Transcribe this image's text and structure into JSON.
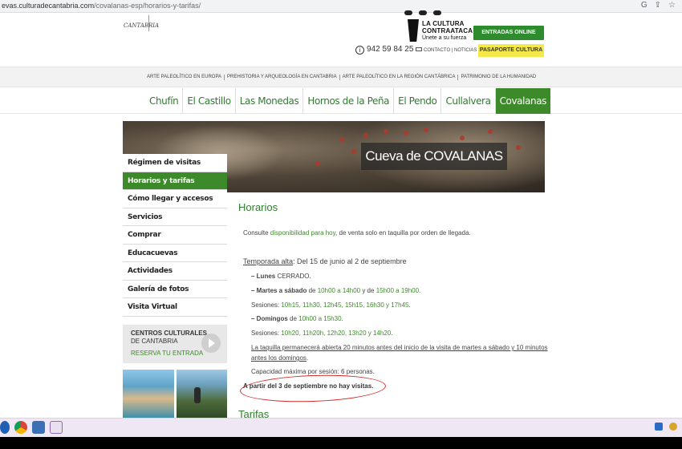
{
  "browser": {
    "url_host": "evas.culturadecantabria.com",
    "url_path": "/covalanas-esp/horarios-y-tarifas/"
  },
  "header": {
    "logo_text": "CANTABRIA",
    "cultura_line1": "LA CULTURA",
    "cultura_line2": "CONTRAATACA",
    "cultura_line3": "Únete a su fuerza",
    "entradas_label": "ENTRADAS ONLINE",
    "pasaporte_label": "PASAPORTE CULTURA",
    "phone": "942 59 84 25",
    "contacto": "CONTACTO",
    "noticias": "NOTICIAS"
  },
  "topnav": {
    "items": [
      "ARTE PALEOLÍTICO EN EUROPA",
      "PREHISTORIA Y ARQUEOLOGÍA EN CANTABRIA",
      "ARTE PALEOLÍTICO EN LA REGIÓN CANTÁBRICA",
      "PATRIMONIO DE LA HUMANIDAD"
    ]
  },
  "cavenav": {
    "tabs": [
      "Chufín",
      "El Castillo",
      "Las Monedas",
      "Hornos de la Peña",
      "El Pendo",
      "Cullalvera",
      "Covalanas"
    ],
    "active_index": 6
  },
  "banner": {
    "title": "Cueva de COVALANAS"
  },
  "sidebar": {
    "items": [
      "Régimen de visitas",
      "Horarios y tarifas",
      "Cómo llegar y accesos",
      "Servicios",
      "Comprar",
      "Educacuevas",
      "Actividades",
      "Galería de fotos",
      "Visita Virtual"
    ],
    "active_index": 1,
    "centros_title": "CENTROS CULTURALES",
    "centros_sub": "DE CANTABRIA",
    "centros_link": "RESERVA TU ENTRADA"
  },
  "content": {
    "heading": "Horarios",
    "intro_pre": "Consulte ",
    "intro_link": "disponibilidad para hoy",
    "intro_post": ", de venta solo en taquilla por orden de llegada.",
    "temporada_label": "Temporada alta",
    "temporada_text": ": Del 15 de junio al 2 de septiembre",
    "lunes_label": "– Lunes",
    "lunes_text": " CERRADO.",
    "martes_label": "– Martes a sábado",
    "martes_pre": " de ",
    "martes_t1": "10h00 a 14h00",
    "martes_mid": " y de ",
    "martes_t2": "15h00 a 19h00",
    "martes_end": ".",
    "sesiones1_label": "Sesiones: ",
    "sesiones1": "10h15, 11h30, 12h45, 15h15, 16h30 y 17h45",
    "sesiones1_end": ".",
    "domingos_label": "– Domingos",
    "domingos_pre": " de ",
    "domingos_t": "10h00 a 15h30",
    "domingos_end": ".",
    "sesiones2_label": "Sesiones: ",
    "sesiones2": "10h20, 11h20h, 12h20, 13h20 y 14h20",
    "sesiones2_end": ".",
    "taquilla_line1": "La taquilla permanecerá abierta 20 minutos antes del inicio de la visita de martes a sábado y 10 minutos",
    "taquilla_line2": "antes los domingos",
    "taquilla_end": ".",
    "capacidad": "Capacidad máxima por sesión: 6 personas.",
    "aviso": "A partir del 3 de septiembre no hay visitas.",
    "tarifas_heading": "Tarifas"
  },
  "colors": {
    "accent_green": "#3c8a2a",
    "text_green": "#2e7d2e",
    "annotation_red": "#d12a2a",
    "pasaporte_yellow": "#f4e84a"
  }
}
